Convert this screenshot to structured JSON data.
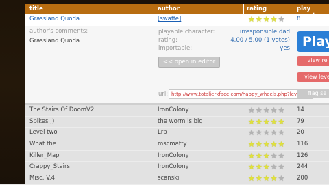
{
  "header": {
    "title": "title",
    "author": "author",
    "rating": "rating",
    "play_count": "play count"
  },
  "selected": {
    "title": "Grassland Quoda",
    "author": "[swaffe]",
    "rating": 4,
    "play_count": "8",
    "comments_label": "author's comments:",
    "comment": "Grassland Quoda",
    "details": [
      {
        "label": "playable character:",
        "value": "irresponsible dad"
      },
      {
        "label": "rating:",
        "value": "4.00 / 5.00 (1 votes)"
      },
      {
        "label": "importable:",
        "value": "yes"
      }
    ],
    "edit_button": "<< open in editor",
    "url_label": "url:",
    "url": "http://www.totaljerkface.com/happy_wheels.php?levelid=",
    "play_label": "Play",
    "side_buttons": [
      "view re",
      "view leve",
      "flag se"
    ]
  },
  "levels": [
    {
      "title": "The Stairs Of DoomV2",
      "author": "IronColony",
      "rating": 0,
      "play_count": "14"
    },
    {
      "title": "Spikes ;)",
      "author": "the worm is big",
      "rating": 5,
      "play_count": "79"
    },
    {
      "title": "Level two",
      "author": "Lrp",
      "rating": 0,
      "play_count": "20"
    },
    {
      "title": "What the",
      "author": "mscmatty",
      "rating": 5,
      "play_count": "116"
    },
    {
      "title": "Killer_Map",
      "author": "IronColony",
      "rating": 3,
      "play_count": "126"
    },
    {
      "title": "Crappy_Stairs",
      "author": "IronColony",
      "rating": 3,
      "play_count": "244"
    },
    {
      "title": "Misc. V.4",
      "author": "scanski",
      "rating": 4,
      "play_count": "200"
    }
  ],
  "colors": {
    "header_bg": "#b86d11",
    "star_on": "#e1e23a",
    "star_off": "#b3b3b3",
    "play_button": "#2a7fd6",
    "link": "#1a5fb4"
  }
}
